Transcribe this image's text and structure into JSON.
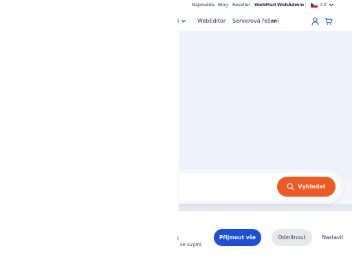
{
  "topbar": {
    "links": [
      "Nápověda",
      "Blog",
      "Reseller",
      "WebMail",
      "WebAdmin"
    ],
    "language": "CZ"
  },
  "nav": {
    "partial_item_fragment": "i",
    "webeditor": "WebEditor",
    "server_solutions": "Serverová řešení"
  },
  "search": {
    "button_label": "Vyhledat",
    "input_value": "",
    "placeholder": ""
  },
  "cookie": {
    "text_line_1": "i",
    "text_line_2": "se svými",
    "accept_label": "Přijmout vše",
    "reject_label": "Odmítnout",
    "settings_label": "Nastavit"
  },
  "colors": {
    "brand_orange": "#f05a22",
    "accept_blue": "#1e4fd8",
    "hero_bg": "#eef2fb",
    "text_dark": "#1c2b4a"
  }
}
